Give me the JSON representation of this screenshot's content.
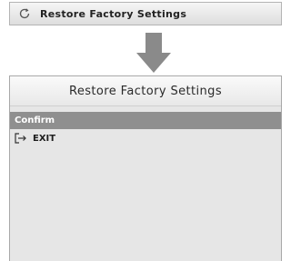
{
  "top_bar": {
    "icon": "refresh-icon",
    "label": "Restore Factory Settings"
  },
  "arrow": {
    "icon": "arrow-down-icon",
    "color": "#8a8a8a"
  },
  "panel": {
    "title": "Restore Factory Settings",
    "items": [
      {
        "label": "Confirm",
        "selected": true
      },
      {
        "label": "EXIT",
        "icon": "exit-icon"
      }
    ]
  },
  "colors": {
    "selected_row": "#8f8f8f",
    "panel_bg": "#e6e6e6"
  }
}
